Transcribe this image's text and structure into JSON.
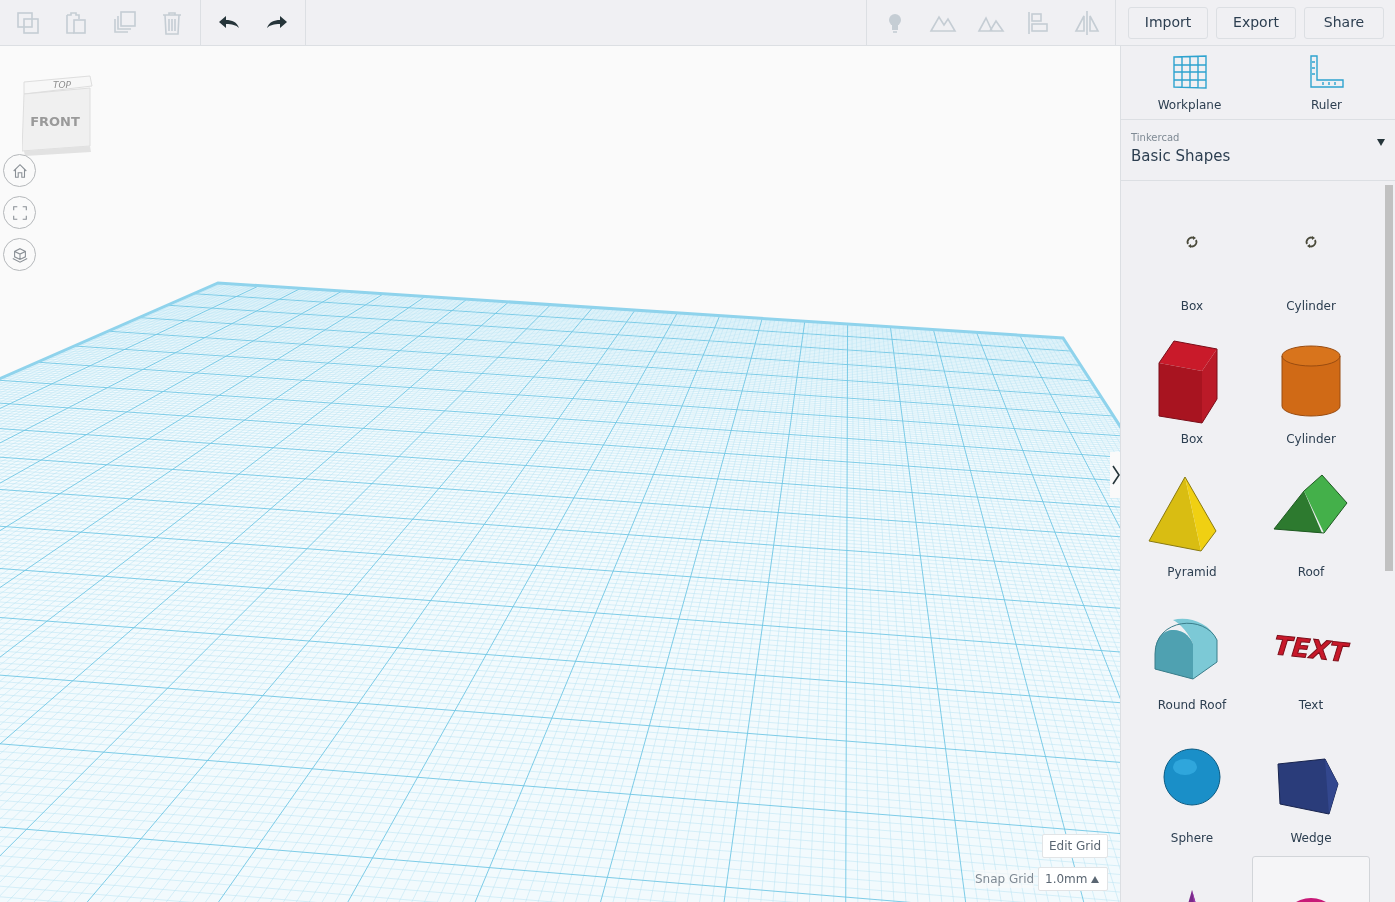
{
  "toolbar": {
    "edit_tools": [
      {
        "kind": "copy",
        "disabled": true
      },
      {
        "kind": "paste",
        "disabled": true
      },
      {
        "kind": "duplicate",
        "disabled": true
      },
      {
        "kind": "delete",
        "disabled": true
      }
    ],
    "history_tools": [
      {
        "kind": "undo",
        "disabled": false
      },
      {
        "kind": "redo",
        "disabled": false
      }
    ],
    "view_tools": [
      {
        "kind": "bulb",
        "disabled": true
      },
      {
        "kind": "solid",
        "disabled": true
      },
      {
        "kind": "hole",
        "disabled": true
      },
      {
        "kind": "align",
        "disabled": true
      },
      {
        "kind": "mirror",
        "disabled": true
      }
    ],
    "buttons": [
      "Import",
      "Export",
      "Share"
    ]
  },
  "view_cube": {
    "top": "TOP",
    "front": "FRONT"
  },
  "view_controls": [
    {
      "kind": "home"
    },
    {
      "kind": "fit"
    },
    {
      "kind": "ortho"
    }
  ],
  "grid_controls": {
    "edit_button": "Edit Grid",
    "snap_label": "Snap Grid",
    "snap_value": "1.0mm"
  },
  "panel": {
    "tools": [
      {
        "kind": "workplane",
        "label": "Workplane"
      },
      {
        "kind": "ruler",
        "label": "Ruler"
      }
    ],
    "library": {
      "provider": "Tinkercad",
      "name": "Basic Shapes"
    },
    "shapes": [
      {
        "kind": "loading",
        "label": "Box",
        "selected": false
      },
      {
        "kind": "loading",
        "label": "Cylinder",
        "selected": false
      },
      {
        "kind": "box",
        "label": "Box",
        "selected": false
      },
      {
        "kind": "cylinder",
        "label": "Cylinder",
        "selected": false
      },
      {
        "kind": "pyramid",
        "label": "Pyramid",
        "selected": false
      },
      {
        "kind": "roof",
        "label": "Roof",
        "selected": false
      },
      {
        "kind": "roundroof",
        "label": "Round Roof",
        "selected": false
      },
      {
        "kind": "text",
        "label": "Text",
        "glyph": "TEXT",
        "selected": false
      },
      {
        "kind": "sphere",
        "label": "Sphere",
        "selected": false
      },
      {
        "kind": "wedge",
        "label": "Wedge",
        "selected": false
      },
      {
        "kind": "cone",
        "selected": false
      },
      {
        "kind": "halfsphere",
        "selected": true
      }
    ]
  }
}
